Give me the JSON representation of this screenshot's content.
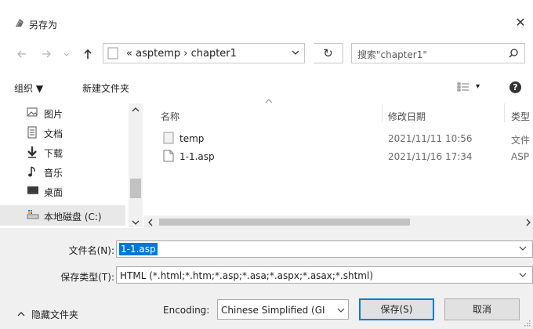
{
  "window": {
    "title": "另存为",
    "close_glyph": "✕"
  },
  "address": {
    "prefix": "«",
    "crumbs": [
      "asptemp",
      "chapter1"
    ],
    "separator": "›",
    "search_placeholder": "搜索\"chapter1\"",
    "refresh_glyph": "↻"
  },
  "toolbar": {
    "organize": "组织 ▼",
    "new_folder": "新建文件夹",
    "view_glyph": "▾",
    "help": "?"
  },
  "sidebar": {
    "items": [
      {
        "label": "图片",
        "icon": "pictures-icon"
      },
      {
        "label": "文档",
        "icon": "documents-icon"
      },
      {
        "label": "下载",
        "icon": "downloads-icon"
      },
      {
        "label": "音乐",
        "icon": "music-icon"
      },
      {
        "label": "桌面",
        "icon": "desktop-icon"
      },
      {
        "label": "本地磁盘 (C:)",
        "icon": "drive-icon",
        "selected": true
      }
    ]
  },
  "file_list": {
    "columns": [
      "名称",
      "修改日期",
      "类型"
    ],
    "rows": [
      {
        "name": "temp",
        "date": "2021/11/11 10:56",
        "type": "文件",
        "icon": "folder-icon"
      },
      {
        "name": "1-1.asp",
        "date": "2021/11/16 17:34",
        "type": "ASP",
        "icon": "file-icon"
      }
    ]
  },
  "form": {
    "filename_label": "文件名(N):",
    "filename_value": "1-1.asp",
    "filetype_label": "保存类型(T):",
    "filetype_value": "HTML (*.html;*.htm;*.asp;*.asa;*.aspx;*.asax;*.shtml)",
    "hide_folders": "隐藏文件夹",
    "encoding_label": "Encoding:",
    "encoding_value": "Chinese Simplified (GI",
    "save_button": "保存(S)",
    "cancel_button": "取消"
  }
}
